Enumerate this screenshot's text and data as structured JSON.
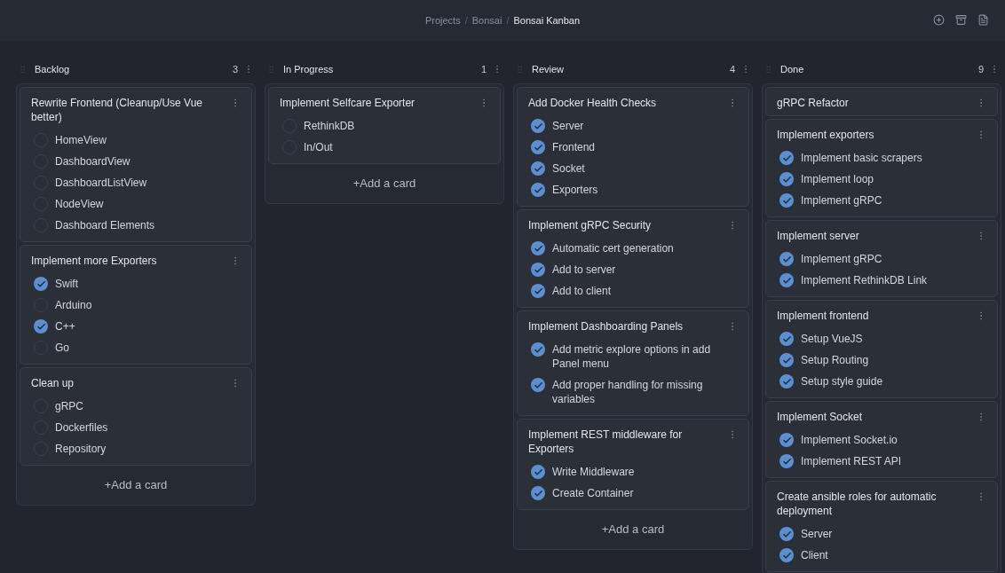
{
  "breadcrumbs": [
    {
      "label": "Projects",
      "selected": false
    },
    {
      "separator": "/",
      "label": "Bonsai",
      "selected": false
    },
    {
      "separator": "/",
      "label": "Bonsai Kanban",
      "selected": true
    }
  ],
  "columns": [
    {
      "title": "Backlog",
      "count": "3",
      "add_label": "+Add a card",
      "cards": [
        {
          "title": "Rewrite Frontend (Cleanup/Use Vue better)",
          "tasks": [
            {
              "label": "HomeView",
              "checked": false
            },
            {
              "label": "DashboardView",
              "checked": false
            },
            {
              "label": "DashboardListView",
              "checked": false
            },
            {
              "label": "NodeView",
              "checked": false
            },
            {
              "label": "Dashboard Elements",
              "checked": false
            }
          ]
        },
        {
          "title": "Implement more Exporters",
          "tasks": [
            {
              "label": "Swift",
              "checked": true
            },
            {
              "label": "Arduino",
              "checked": false
            },
            {
              "label": "C++",
              "checked": true
            },
            {
              "label": "Go",
              "checked": false
            }
          ]
        },
        {
          "title": "Clean up",
          "tasks": [
            {
              "label": "gRPC",
              "checked": false
            },
            {
              "label": "Dockerfiles",
              "checked": false
            },
            {
              "label": "Repository",
              "checked": false
            }
          ]
        }
      ]
    },
    {
      "title": "In Progress",
      "count": "1",
      "add_label": "+Add a card",
      "cards": [
        {
          "title": "Implement Selfcare Exporter",
          "tasks": [
            {
              "label": "RethinkDB",
              "checked": false
            },
            {
              "label": "In/Out",
              "checked": false
            }
          ]
        }
      ]
    },
    {
      "title": "Review",
      "count": "4",
      "add_label": "+Add a card",
      "cards": [
        {
          "title": "Add Docker Health Checks",
          "tasks": [
            {
              "label": "Server",
              "checked": true
            },
            {
              "label": "Frontend",
              "checked": true
            },
            {
              "label": "Socket",
              "checked": true
            },
            {
              "label": "Exporters",
              "checked": true
            }
          ]
        },
        {
          "title": "Implement gRPC Security",
          "tasks": [
            {
              "label": "Automatic cert generation",
              "checked": true
            },
            {
              "label": "Add to server",
              "checked": true
            },
            {
              "label": "Add to client",
              "checked": true
            }
          ]
        },
        {
          "title": "Implement Dashboarding Panels",
          "tasks": [
            {
              "label": "Add metric explore options in add Panel menu",
              "checked": true
            },
            {
              "label": "Add proper handling for missing variables",
              "checked": true
            }
          ]
        },
        {
          "title": "Implement REST middleware for Exporters",
          "tasks": [
            {
              "label": "Write Middleware",
              "checked": true
            },
            {
              "label": "Create Container",
              "checked": true
            }
          ]
        }
      ]
    },
    {
      "title": "Done",
      "count": "9",
      "cards": [
        {
          "title": "gRPC Refactor"
        },
        {
          "title": "Implement exporters",
          "tasks": [
            {
              "label": "Implement basic scrapers",
              "checked": true
            },
            {
              "label": "Implement loop",
              "checked": true
            },
            {
              "label": "Implement gRPC",
              "checked": true
            }
          ]
        },
        {
          "title": "Implement server",
          "tasks": [
            {
              "label": "Implement gRPC",
              "checked": true
            },
            {
              "label": "Implement RethinkDB Link",
              "checked": true
            }
          ]
        },
        {
          "title": "Implement frontend",
          "tasks": [
            {
              "label": "Setup VueJS",
              "checked": true
            },
            {
              "label": "Setup Routing",
              "checked": true
            },
            {
              "label": "Setup style guide",
              "checked": true
            }
          ]
        },
        {
          "title": "Implement Socket",
          "tasks": [
            {
              "label": "Implement Socket.io",
              "checked": true
            },
            {
              "label": "Implement REST API",
              "checked": true
            }
          ]
        },
        {
          "title": "Create ansible roles for automatic deployment",
          "tasks": [
            {
              "label": "Server",
              "checked": true
            },
            {
              "label": "Client",
              "checked": true
            }
          ]
        }
      ]
    }
  ]
}
